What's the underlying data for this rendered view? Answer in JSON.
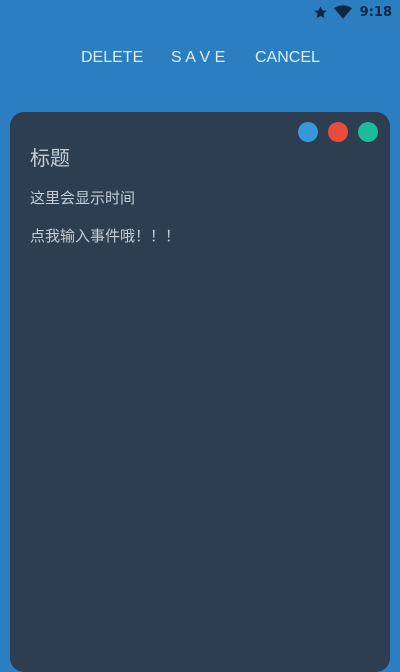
{
  "status_bar": {
    "time": "9:18",
    "icons": [
      "star-icon",
      "wifi-icon"
    ]
  },
  "toolbar": {
    "delete_label": "DELETE",
    "save_label": "S A V E",
    "cancel_label": "CANCEL"
  },
  "note": {
    "title": "标题",
    "time_placeholder": "这里会显示时间",
    "content_placeholder": "点我输入事件哦！！！"
  },
  "color_options": [
    {
      "name": "blue",
      "color": "#3498db"
    },
    {
      "name": "red",
      "color": "#e74c3c"
    },
    {
      "name": "green",
      "color": "#1abc9c"
    }
  ],
  "colors": {
    "background": "#2b7fc0",
    "card": "#2d3e50",
    "text": "#c3ccd6",
    "toolbar_text": "#dcecf8"
  }
}
